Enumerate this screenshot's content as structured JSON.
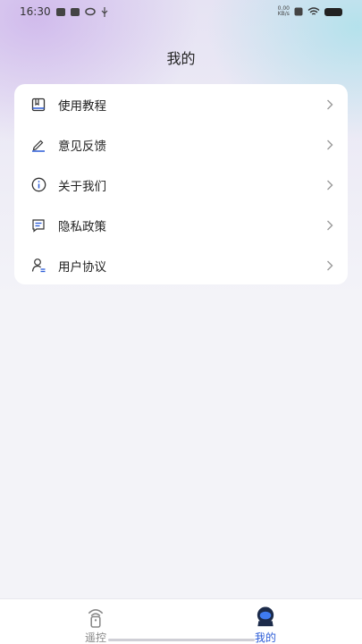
{
  "status_bar": {
    "time": "16:30",
    "net_speed_value": "0.00",
    "net_speed_unit": "KB/s"
  },
  "header": {
    "title": "我的"
  },
  "menu": {
    "items": [
      {
        "label": "使用教程",
        "icon": "book-icon"
      },
      {
        "label": "意见反馈",
        "icon": "edit-pen-icon"
      },
      {
        "label": "关于我们",
        "icon": "info-icon"
      },
      {
        "label": "隐私政策",
        "icon": "document-icon"
      },
      {
        "label": "用户协议",
        "icon": "user-agreement-icon"
      }
    ]
  },
  "bottom_nav": {
    "tabs": [
      {
        "label": "遥控",
        "icon": "remote-icon",
        "active": false
      },
      {
        "label": "我的",
        "icon": "profile-icon",
        "active": true
      }
    ],
    "active_color": "#2a5bd7",
    "inactive_color": "#888888"
  }
}
